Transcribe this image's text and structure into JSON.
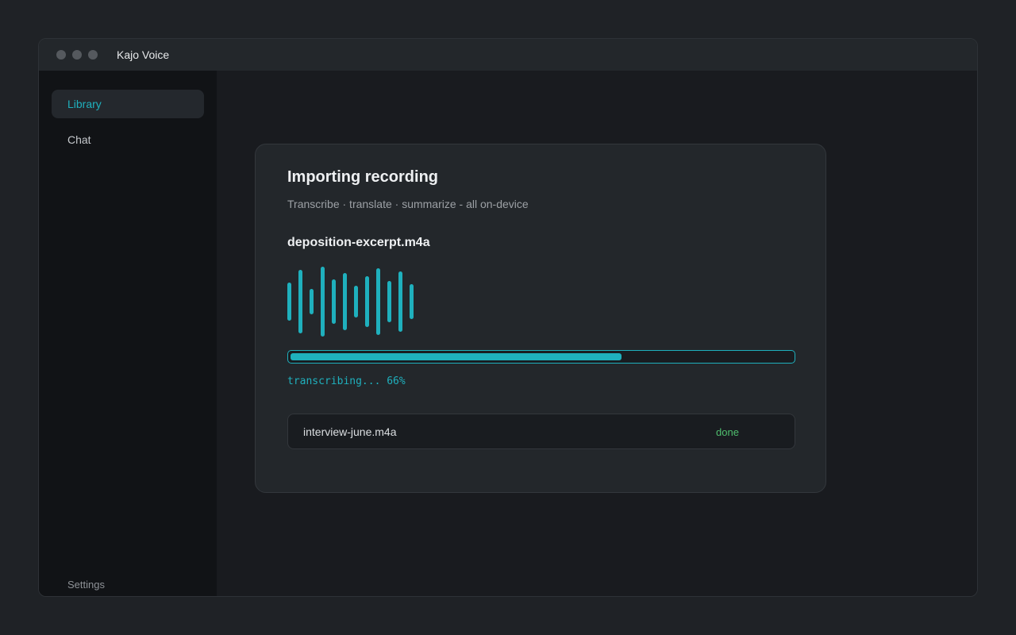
{
  "app": {
    "title": "Kajo Voice"
  },
  "sidebar": {
    "items": [
      {
        "label": "Library",
        "active": true
      },
      {
        "label": "Chat",
        "active": false
      }
    ],
    "footer": {
      "label": "Settings"
    }
  },
  "import_card": {
    "title": "Importing recording",
    "subtitle": "Transcribe · translate · summarize - all on-device",
    "file_name": "deposition-excerpt.m4a",
    "waveform_icon": "waveform-icon",
    "progress_percent": 66,
    "status_text": "transcribing... 66%"
  },
  "queue": [
    {
      "name": "interview-june.m4a",
      "status": "done"
    }
  ],
  "colors": {
    "accent": "#1fb0bd",
    "done": "#4fbe6e",
    "background": "#1f2226",
    "card": "#23272b"
  }
}
